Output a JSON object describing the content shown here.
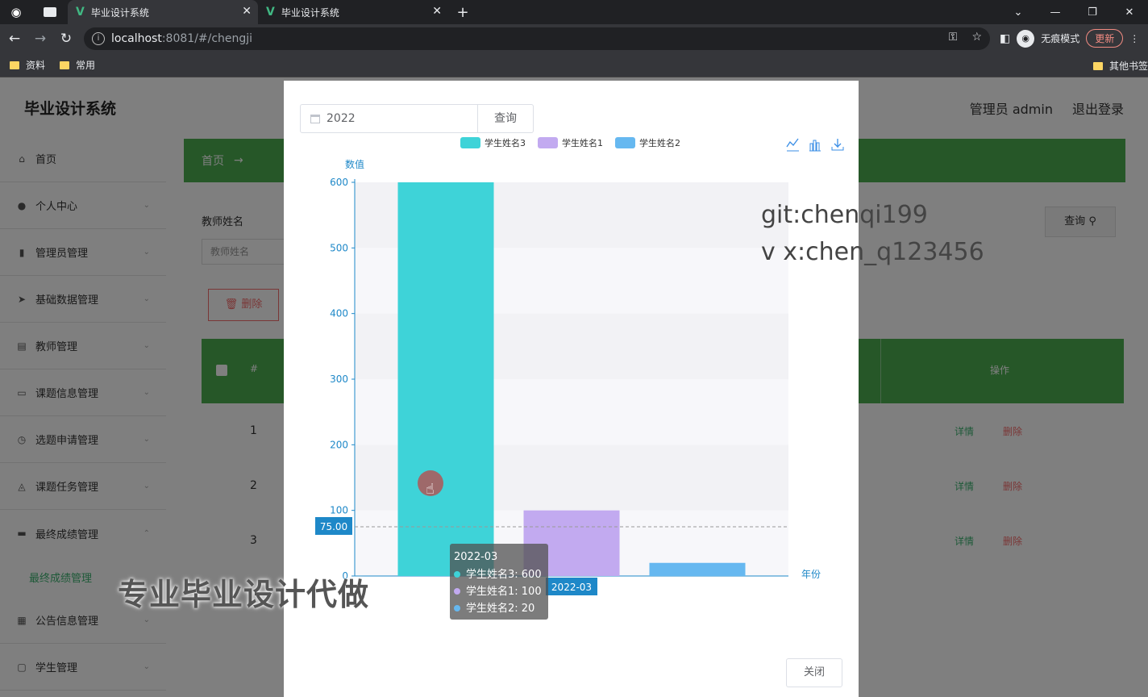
{
  "browser": {
    "tabs": [
      {
        "title": "毕业设计系统",
        "active": true
      },
      {
        "title": "毕业设计系统",
        "active": false
      }
    ],
    "url_host": "localhost",
    "url_path": ":8081/#/chengji",
    "incognito_label": "无痕模式",
    "update_label": "更新",
    "bookmarks": [
      "资料",
      "常用"
    ],
    "other_bookmarks": "其他书签"
  },
  "app": {
    "title": "毕业设计系统",
    "admin_label": "管理员 admin",
    "logout_label": "退出登录",
    "menu": [
      {
        "label": "首页",
        "icon": "home-icon"
      },
      {
        "label": "个人中心",
        "icon": "user-icon"
      },
      {
        "label": "管理员管理",
        "icon": "bar-chart-icon"
      },
      {
        "label": "基础数据管理",
        "icon": "send-icon"
      },
      {
        "label": "教师管理",
        "icon": "list-icon"
      },
      {
        "label": "课题信息管理",
        "icon": "message-icon"
      },
      {
        "label": "选题申请管理",
        "icon": "clock-icon"
      },
      {
        "label": "课题任务管理",
        "icon": "task-icon"
      },
      {
        "label": "最终成绩管理",
        "icon": "monitor-icon"
      },
      {
        "label": "公告信息管理",
        "icon": "notice-icon"
      },
      {
        "label": "学生管理",
        "icon": "user-box-icon"
      }
    ],
    "submenu_active": "最终成绩管理",
    "breadcrumb_home": "首页",
    "breadcrumb_arrow": "→",
    "search_label": "教师姓名",
    "search_placeholder": "教师姓名",
    "search_button": "查询",
    "delete_button": "删除",
    "table_rows": [
      "1",
      "2",
      "3"
    ],
    "row_detail": "详情",
    "row_delete": "删除",
    "table_header_op": "操作"
  },
  "dialog": {
    "year_value": "2022",
    "query_button": "查询",
    "close_button": "关闭"
  },
  "chart_data": {
    "type": "bar",
    "ylabel": "数值",
    "xlabel": "年份",
    "ylim": [
      0,
      600
    ],
    "yticks": [
      0,
      100,
      200,
      300,
      400,
      500,
      600
    ],
    "categories": [
      "2022-03"
    ],
    "series": [
      {
        "name": "学生姓名3",
        "color": "#3ed3d8",
        "values": [
          600
        ]
      },
      {
        "name": "学生姓名1",
        "color": "#c2aaf0",
        "values": [
          100
        ]
      },
      {
        "name": "学生姓名2",
        "color": "#66b8f0",
        "values": [
          20
        ]
      }
    ],
    "legend_position": "top",
    "toolbox": [
      "line-chart-icon",
      "bar-chart-icon",
      "download-icon"
    ],
    "pointer_value_label": "75.00",
    "axis_pointer_category": "2022-03",
    "tooltip": {
      "title": "2022-03",
      "lines": [
        "学生姓名3: 600",
        "学生姓名1: 100",
        "学生姓名2: 20"
      ]
    }
  },
  "overlays": {
    "watermark_line1": "git:chenqi199",
    "watermark_line2": "v x:chen_q123456",
    "promo": "专业毕业设计代做"
  }
}
